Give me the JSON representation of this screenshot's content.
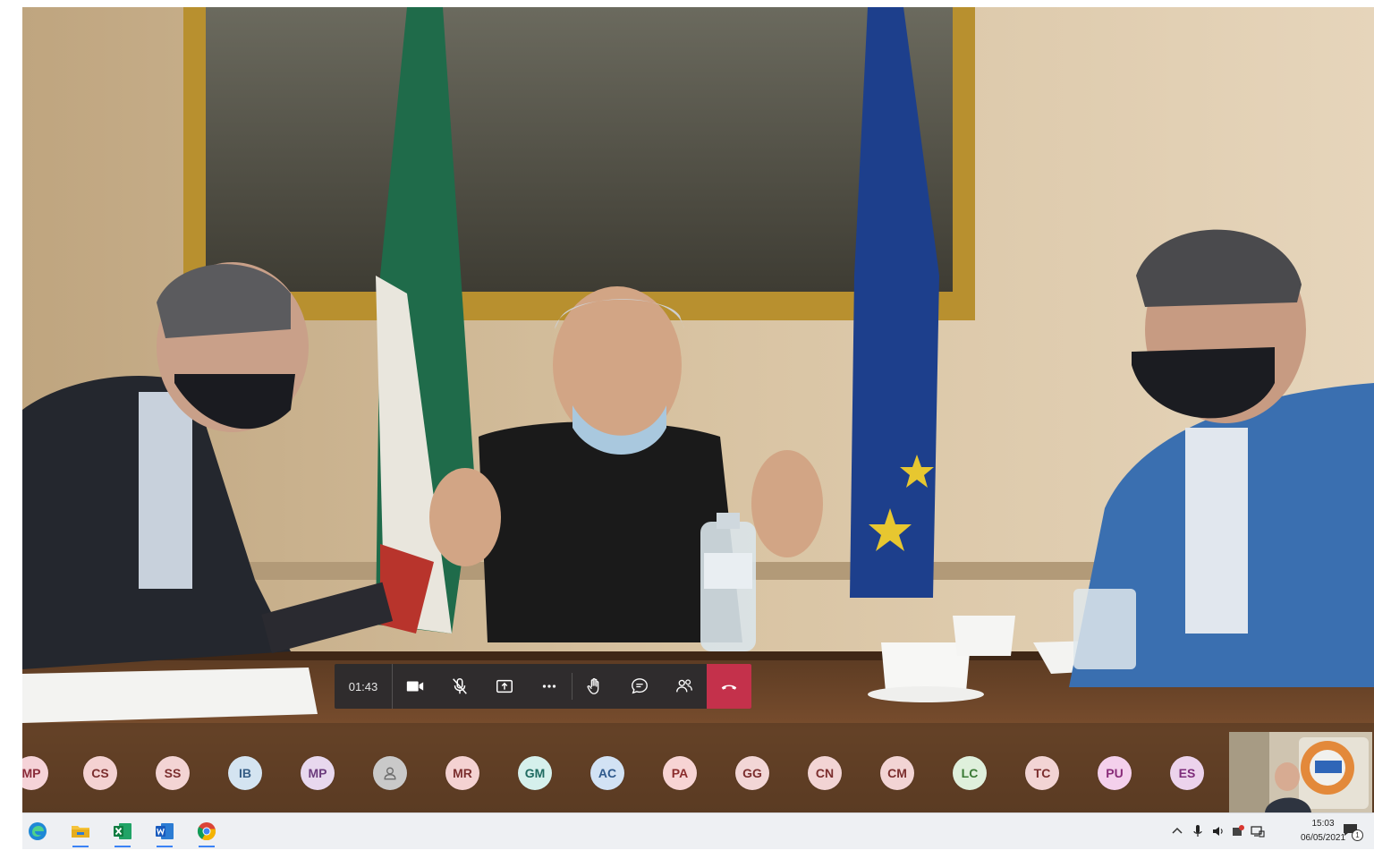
{
  "call": {
    "timer": "01:43",
    "participants": [
      "MP",
      "CS",
      "SS",
      "IB",
      "MP",
      "",
      "MR",
      "GM",
      "AC",
      "PA",
      "GG",
      "CN",
      "CM",
      "LC",
      "TC",
      "PU",
      "ES"
    ],
    "avatar_colors": [
      "#f5d3d8",
      "#f4d2d2",
      "#f3d4d4",
      "#d4e4f1",
      "#e8d8ee",
      "#c9c9c9",
      "#f4d2d2",
      "#d5f0ec",
      "#d2e2f4",
      "#f7d4d4",
      "#f2d6d6",
      "#f2d4d4",
      "#f2d4d4",
      "#dff0dc",
      "#f2d4d4",
      "#f4d0ec",
      "#ecd3ec"
    ],
    "avatar_text_colors": [
      "#8a2c3a",
      "#7b2e2e",
      "#7b2e2e",
      "#355d85",
      "#6c3c7d",
      "#6b6b6b",
      "#7b2e2e",
      "#1f6b61",
      "#2f5a8d",
      "#8a2c2c",
      "#7b2e2e",
      "#7b2e2e",
      "#7b2e2e",
      "#3a7a35",
      "#7b2e2e",
      "#8a2c7a",
      "#7d2c7a"
    ],
    "hangup_color": "#c4314b"
  },
  "taskbar": {
    "apps": [
      "edge-icon",
      "file-explorer-icon",
      "excel-icon",
      "word-icon",
      "chrome-icon"
    ],
    "time": "15:03",
    "date": "06/05/2021",
    "notification_count": "1"
  }
}
